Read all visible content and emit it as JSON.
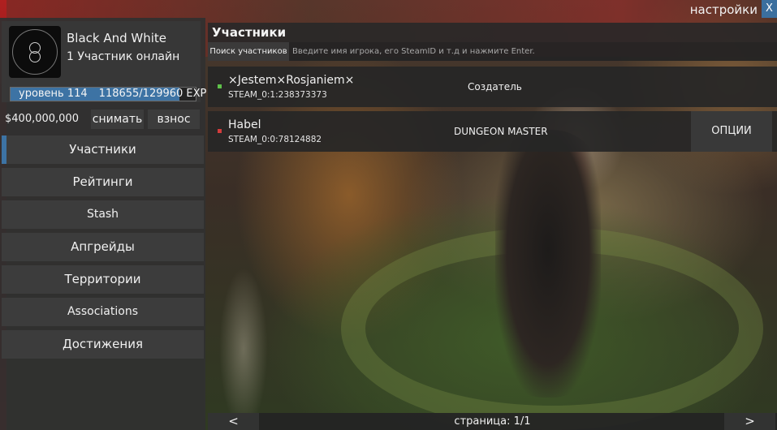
{
  "header": {
    "settings_label": "настройки",
    "close_label": "X"
  },
  "profile": {
    "group_name": "Black And White",
    "online": "1 Участник онлайн",
    "level_label": "уровень 114",
    "exp_label": "118655/129960 EXP",
    "exp_fraction": 0.913
  },
  "money": {
    "amount": "$400,000,000",
    "withdraw_label": "снимать",
    "deposit_label": "взнос"
  },
  "nav": {
    "items": [
      {
        "label": "Участники",
        "active": true
      },
      {
        "label": "Рейтинги",
        "active": false
      },
      {
        "label": "Stash",
        "active": false
      },
      {
        "label": "Апгрейды",
        "active": false
      },
      {
        "label": "Территории",
        "active": false
      },
      {
        "label": "Associations",
        "active": false
      },
      {
        "label": "Достижения",
        "active": false
      }
    ]
  },
  "members_panel": {
    "title": "Участники",
    "search_label": "Поиск участников",
    "search_placeholder": "Введите имя игрока, его SteamID и т.д и нажмите Enter.",
    "members": [
      {
        "name": "×Jestem×Rosjaniem×",
        "steam_id": "STEAM_0:1:238373373",
        "role": "Создатель",
        "status": "online",
        "status_color": "#5fc24a"
      },
      {
        "name": "Habel",
        "steam_id": "STEAM_0:0:78124882",
        "role": "DUNGEON MASTER",
        "status": "offline",
        "status_color": "#d23c3c",
        "options_label": "ОПЦИИ"
      }
    ]
  },
  "pager": {
    "prev_label": "<",
    "next_label": ">",
    "page_text": "страница: 1/1"
  },
  "colors": {
    "accent": "#3d73a4",
    "online": "#5fc24a",
    "offline": "#d23c3c"
  }
}
